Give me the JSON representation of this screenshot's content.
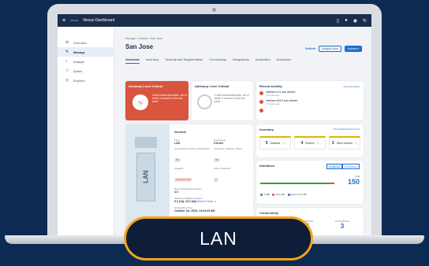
{
  "app": {
    "brand": "cisco",
    "title": "Nexus Dashboard",
    "header_icons": [
      "tablet-icon",
      "user-icon",
      "help-icon",
      "refresh-icon"
    ]
  },
  "sidebar": {
    "items": [
      {
        "label": "Overview",
        "icon": "grid-icon"
      },
      {
        "label": "Manage",
        "icon": "wrench-icon",
        "active": true
      },
      {
        "label": "Analyze",
        "icon": "search-icon"
      },
      {
        "label": "Admin",
        "icon": "users-icon"
      },
      {
        "label": "Explorer",
        "icon": "compass-icon"
      }
    ]
  },
  "page": {
    "breadcrumb": "Manage  >  Fabrics  >  San Jose",
    "title": "San Jose",
    "refresh": "Refresh",
    "analyze_now": "Analyze Now",
    "actions": "Actions ▾"
  },
  "tabs": [
    "Overview",
    "Inventory",
    "Security and Segmentation",
    "Connectivity",
    "Integrations",
    "Anomalies",
    "Advisories"
  ],
  "anomaly": {
    "title": "Anomaly Level Critical",
    "text": "4 total critical anomalies, out of which 3 occurred in the last week"
  },
  "advisory": {
    "title": "Advisory Level Critical",
    "text": "2 total critical advisories, out of which 3 occurred in the last week"
  },
  "recent": {
    "title": "Recent Activity",
    "view_all": "View All Activity",
    "items": [
      {
        "text": "Interface e1/1 was deleted",
        "time": "2 minutes ago"
      },
      {
        "text": "Interface e8/1/3 was deleted",
        "time": "5 minutes ago"
      },
      {
        "text": "",
        "time": ""
      }
    ]
  },
  "general": {
    "title": "General",
    "illus_label": "LAN",
    "fields": [
      {
        "k": "Type",
        "v": "LAN"
      },
      {
        "k": "Technology",
        "v": "VXLAN"
      },
      {
        "k": "Connectivity to Nexus Dashboard",
        "v": "OK",
        "pill": "green"
      },
      {
        "k": "Telemetry Collection Status",
        "v": "OK",
        "pill": "green"
      },
      {
        "k": "Capacity",
        "v": "Crossed Limits",
        "pill": "red"
      },
      {
        "k": "Active Sessions",
        "v": "3",
        "pill": "blue"
      }
    ],
    "version_k": "Nexus Dashboard Version",
    "version_v": "4.0",
    "software_k": "Switches Software Version",
    "software_v": "9.3 (1a), 10.2 (3a)",
    "software_link": "Show 3 more",
    "onboarding_k": "Onboarding Time",
    "onboarding_v": "October 1st, 2023, 14:03:23 AM"
  },
  "inventory": {
    "title": "Inventory",
    "view_all": "View Detailed Resources",
    "items": [
      {
        "count": "5",
        "label": "Switches"
      },
      {
        "count": "4",
        "label": "Routers"
      },
      {
        "count": "2",
        "label": "Other Devices"
      }
    ]
  },
  "interfaces": {
    "title": "Interfaces",
    "toggle_on": "Configured",
    "toggle_off": "All Interfaces",
    "total_label": "Total",
    "total": "150",
    "legend": [
      {
        "label": "Up",
        "value": "98",
        "color": "#2e9e44"
      },
      {
        "label": "Down",
        "value": "36",
        "color": "#d9553d"
      },
      {
        "label": "Admin Down",
        "value": "16",
        "color": "#1f6fd1"
      }
    ]
  },
  "connectivity": {
    "title": "Connectivity",
    "items": [
      {
        "k": "Networks",
        "v": ""
      },
      {
        "k": "Endpoints",
        "v": "5"
      },
      {
        "k": "L3 Neighbors",
        "v": "3"
      }
    ]
  },
  "overlay": {
    "label": "LAN"
  },
  "colors": {
    "background": "#0d2a52",
    "critical": "#d9553d",
    "accent": "#1f6fd1",
    "overlay_border": "#f3a51b"
  }
}
